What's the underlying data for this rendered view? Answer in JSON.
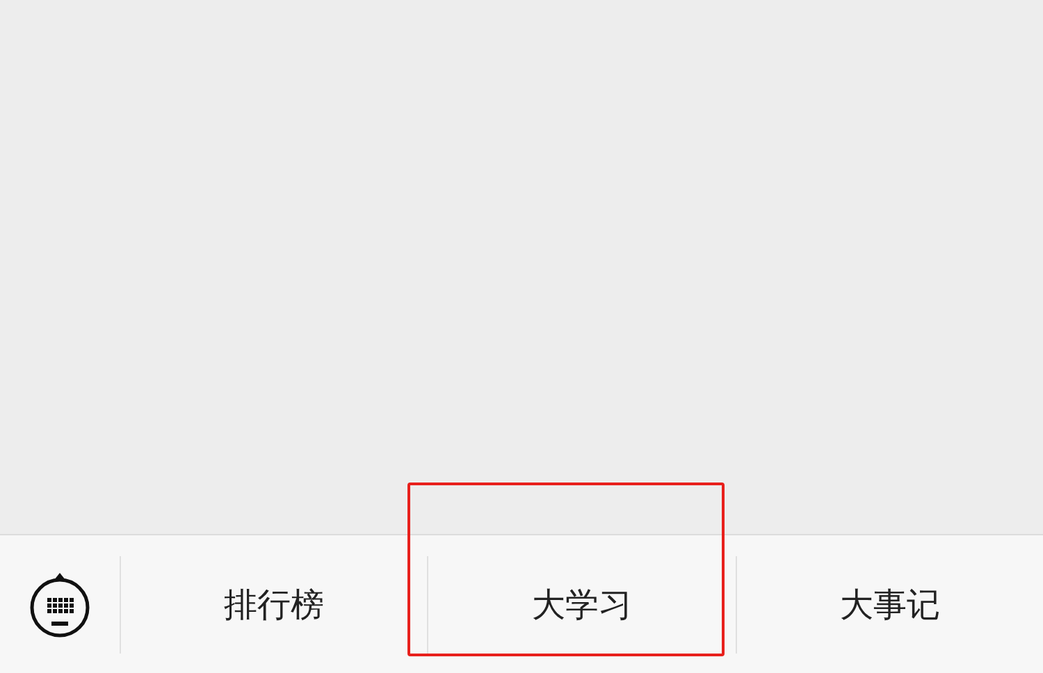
{
  "menu": {
    "items": [
      {
        "label": "排行榜",
        "selected": false
      },
      {
        "label": "大学习",
        "selected": true
      },
      {
        "label": "大事记",
        "selected": false
      }
    ]
  }
}
